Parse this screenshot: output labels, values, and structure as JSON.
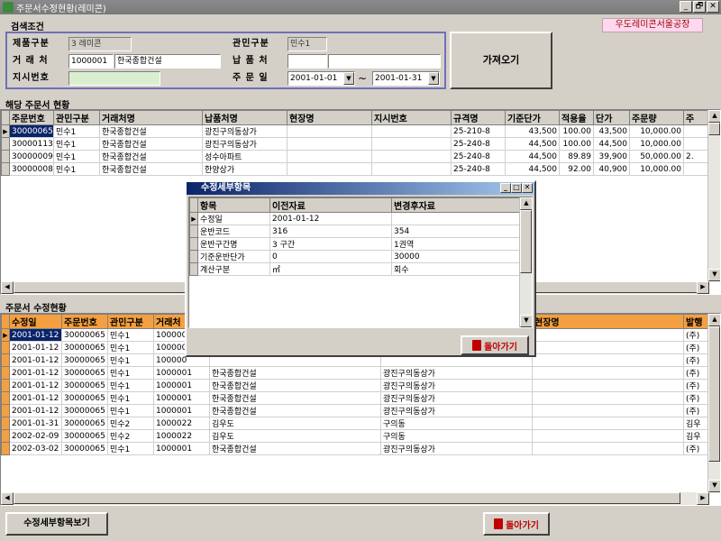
{
  "window": {
    "title": "주문서수정현황(레미콘)",
    "controls": [
      "_",
      "🗗",
      "✕"
    ]
  },
  "search": {
    "section_label": "검색조건",
    "company_badge": "우도레미콘서울공장",
    "product_label": "제품구분",
    "product_value": "3 레미콘",
    "client_label": "거 래 처",
    "client_code": "1000001",
    "client_name": "한국종합건설",
    "instruction_label": "지시번호",
    "instruction_value": "",
    "public_private_label": "관민구분",
    "public_private_value": "민수1",
    "delivery_label": "납 품 처",
    "delivery_code": "",
    "delivery_name": "",
    "order_date_label": "주 문 일",
    "date_from": "2001-01-01",
    "date_tilde": "~",
    "date_to": "2001-01-31",
    "fetch_button": "가져오기"
  },
  "orders": {
    "section_label": "해당 주문서 현황",
    "columns": [
      "주문번호",
      "관민구분",
      "거래처명",
      "납품처명",
      "현장명",
      "지시번호",
      "규격명",
      "기준단가",
      "적용율",
      "단가",
      "주문량",
      "주"
    ],
    "rows": [
      [
        "30000065",
        "민수1",
        "한국종합건설",
        "광진구의동상가",
        "",
        "",
        "25-210-8",
        "43,500",
        "100.00",
        "43,500",
        "10,000.00",
        ""
      ],
      [
        "30000113",
        "민수1",
        "한국종합건설",
        "광진구의동상가",
        "",
        "",
        "25-240-8",
        "44,500",
        "100.00",
        "44,500",
        "10,000.00",
        ""
      ],
      [
        "30000009",
        "민수1",
        "한국종합건설",
        "성수아파트",
        "",
        "",
        "25-240-8",
        "44,500",
        "89.89",
        "39,900",
        "50,000.00",
        "2."
      ],
      [
        "30000008",
        "민수1",
        "한국종합건설",
        "한양상가",
        "",
        "",
        "25-240-8",
        "44,500",
        "92.00",
        "40,900",
        "10,000.00",
        ""
      ]
    ]
  },
  "modifications": {
    "section_label": "주문서 수정현황",
    "columns": [
      "수정일",
      "주문번호",
      "관민구분",
      "거래처",
      "",
      "",
      "현장명",
      "발행"
    ],
    "rows": [
      [
        "2001-01-12",
        "30000065",
        "민수1",
        "100000",
        "",
        "",
        "",
        "(주)"
      ],
      [
        "2001-01-12",
        "30000065",
        "민수1",
        "100000",
        "",
        "",
        "",
        "(주)"
      ],
      [
        "2001-01-12",
        "30000065",
        "민수1",
        "100000",
        "",
        "",
        "",
        "(주)"
      ],
      [
        "2001-01-12",
        "30000065",
        "민수1",
        "1000001",
        "한국종합건설",
        "광진구의동상가",
        "",
        "(주)"
      ],
      [
        "2001-01-12",
        "30000065",
        "민수1",
        "1000001",
        "한국종합건설",
        "광진구의동상가",
        "",
        "(주)"
      ],
      [
        "2001-01-12",
        "30000065",
        "민수1",
        "1000001",
        "한국종합건설",
        "광진구의동상가",
        "",
        "(주)"
      ],
      [
        "2001-01-12",
        "30000065",
        "민수1",
        "1000001",
        "한국종합건설",
        "광진구의동상가",
        "",
        "(주)"
      ],
      [
        "2001-01-31",
        "30000065",
        "민수2",
        "1000022",
        "김우도",
        "구의동",
        "",
        "김우"
      ],
      [
        "2002-02-09",
        "30000065",
        "민수2",
        "1000022",
        "김우도",
        "구의동",
        "",
        "김우"
      ],
      [
        "2002-03-02",
        "30000065",
        "민수1",
        "1000001",
        "한국종합건설",
        "광진구의동상가",
        "",
        "(주)"
      ]
    ]
  },
  "dialog": {
    "title": "수정세부항목",
    "controls": [
      "_",
      "□",
      "✕"
    ],
    "columns": [
      "항목",
      "이전자료",
      "변경후자료"
    ],
    "rows": [
      [
        "수정일",
        "2001-01-12",
        ""
      ],
      [
        "운반코드",
        "316",
        "354"
      ],
      [
        "운반구간명",
        "3 구간",
        "1권역"
      ],
      [
        "기준운반단가",
        "0",
        "30000"
      ],
      [
        "계산구분",
        "㎥",
        "회수"
      ]
    ],
    "back_button": "돌아가기"
  },
  "footer": {
    "detail_button": "수정세부항목보기",
    "back_button": "돌아가기"
  },
  "colors": {
    "title_bar": "#7f7f7f",
    "selection": "#0a246a",
    "header_orange": "#f4a040",
    "search_border": "#6f6fb8",
    "badge_bg": "#ffd8ee"
  }
}
